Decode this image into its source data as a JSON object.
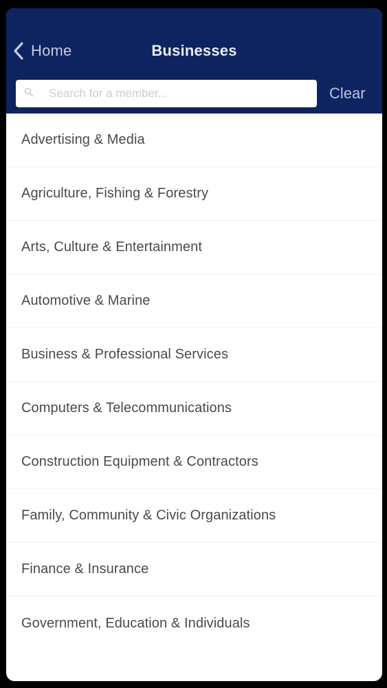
{
  "nav": {
    "back_label": "Home",
    "title": "Businesses"
  },
  "search": {
    "placeholder": "Search for a member...",
    "value": "",
    "clear_label": "Clear"
  },
  "categories": [
    {
      "label": "Advertising & Media"
    },
    {
      "label": "Agriculture, Fishing & Forestry"
    },
    {
      "label": "Arts, Culture & Entertainment"
    },
    {
      "label": "Automotive & Marine"
    },
    {
      "label": "Business & Professional Services"
    },
    {
      "label": "Computers & Telecommunications"
    },
    {
      "label": "Construction Equipment & Contractors"
    },
    {
      "label": "Family, Community & Civic Organizations"
    },
    {
      "label": "Finance & Insurance"
    },
    {
      "label": "Government, Education & Individuals"
    }
  ],
  "colors": {
    "navbar": "#0e2461",
    "nav_text": "#c5cde2",
    "list_text": "#4a4a4a"
  },
  "icons": {
    "back": "chevron-left-icon",
    "search": "magnifier-icon"
  }
}
